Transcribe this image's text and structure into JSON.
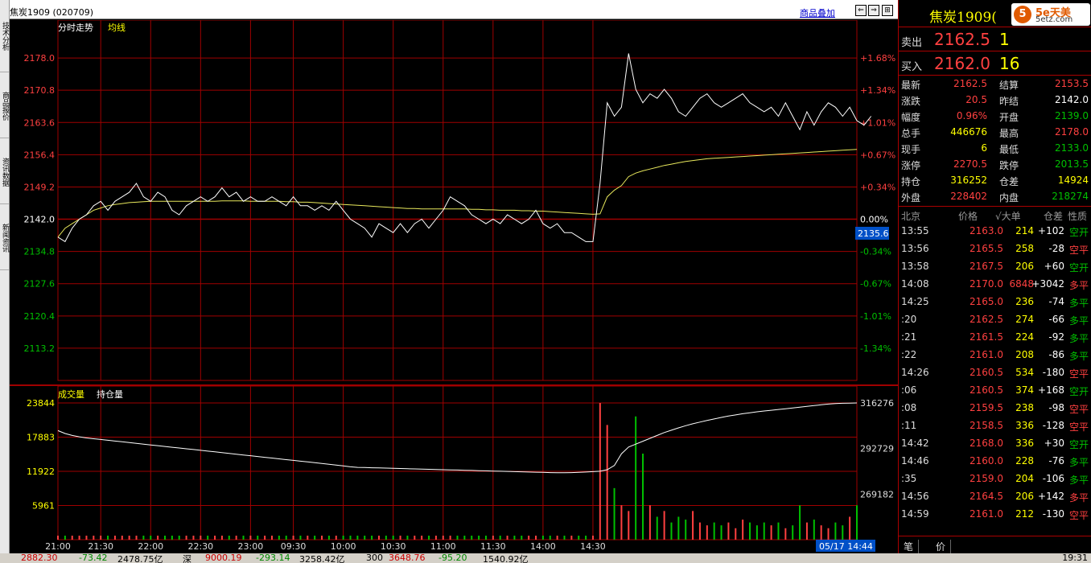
{
  "window": {
    "title": "焦炭1909 (020709)",
    "overlay_link": "商品叠加"
  },
  "side_tabs": [
    "技术分析",
    "商品报价",
    "资讯数据",
    "新闻资讯"
  ],
  "price_chart": {
    "legend_main": "分时走势",
    "legend_avg": "均线",
    "left_ticks": [
      "2178.0",
      "2170.8",
      "2163.6",
      "2156.4",
      "2149.2",
      "2142.0",
      "2134.8",
      "2127.6",
      "2120.4",
      "2113.2"
    ],
    "right_ticks": [
      "+1.68%",
      "+1.34%",
      "+1.01%",
      "+0.67%",
      "+0.34%",
      "0.00%",
      "-0.34%",
      "-0.67%",
      "-1.01%",
      "-1.34%"
    ],
    "cursor_price": "2135.6",
    "colors": {
      "up": "#ff4040",
      "down": "#00c000",
      "flat": "#ffffff",
      "grid": "#a00000",
      "avg": "#e8e85c",
      "line": "#ffffff"
    }
  },
  "volume_chart": {
    "legend_vol": "成交量",
    "legend_oi": "持仓量",
    "left_ticks": [
      "23844",
      "17883",
      "11922",
      "5961"
    ],
    "right_ticks": [
      "316276",
      "292729",
      "269182"
    ]
  },
  "x_axis": [
    "21:00",
    "21:30",
    "22:00",
    "22:30",
    "23:00",
    "09:30",
    "10:00",
    "10:30",
    "11:00",
    "11:30",
    "14:00",
    "14:30"
  ],
  "time_readout": "05/17 14:44",
  "chart_data": {
    "type": "line",
    "title": "",
    "xlabel": "",
    "ylabel": "",
    "ylim": [
      2106.0,
      2185.2
    ],
    "y_axis_ticks": [
      2178.0,
      2170.8,
      2163.6,
      2156.4,
      2149.2,
      2142.0,
      2134.8,
      2127.6,
      2120.4,
      2113.2
    ],
    "x_ticks": [
      "21:00",
      "21:30",
      "22:00",
      "22:30",
      "23:00",
      "09:30",
      "10:00",
      "10:30",
      "11:00",
      "11:30",
      "14:00",
      "14:30"
    ],
    "x_range": [
      0,
      112
    ],
    "x_tick_positions": [
      0,
      6,
      13,
      20,
      27,
      33,
      40,
      47,
      54,
      61,
      68,
      75
    ],
    "series": [
      {
        "values": [
          2138,
          2137,
          2140,
          2142,
          2143,
          2145,
          2146,
          2144,
          2146,
          2147,
          2148,
          2150,
          2147,
          2146,
          2148,
          2147,
          2144,
          2143,
          2145,
          2146,
          2147,
          2146,
          2147,
          2149,
          2147,
          2148,
          2146,
          2147,
          2146,
          2146,
          2147,
          2146,
          2145,
          2147,
          2145,
          2145,
          2144,
          2145,
          2144,
          2146,
          2144,
          2142,
          2141,
          2140,
          2138,
          2141,
          2140,
          2139,
          2141,
          2139,
          2141,
          2142,
          2140,
          2142,
          2144,
          2147,
          2146,
          2145,
          2143,
          2142,
          2141,
          2142,
          2141,
          2143,
          2142,
          2141,
          2142,
          2144,
          2141,
          2140,
          2141,
          2139,
          2139,
          2138,
          2137,
          2137,
          2150,
          2168,
          2165,
          2167,
          2179,
          2171,
          2168,
          2170,
          2169,
          2171,
          2169,
          2166,
          2165,
          2167,
          2169,
          2170,
          2168,
          2167,
          2168,
          2169,
          2170,
          2168,
          2167,
          2166,
          2167,
          2165,
          2168,
          2165,
          2162,
          2166,
          2163,
          2166,
          2168,
          2167,
          2165,
          2167,
          2164,
          2163,
          2165
        ]
      },
      {
        "values": [
          2138,
          2140,
          2141,
          2142,
          2143,
          2144,
          2144.5,
          2145,
          2145.3,
          2145.5,
          2145.7,
          2145.8,
          2145.9,
          2146,
          2146,
          2146,
          2146,
          2146,
          2146,
          2146,
          2146,
          2146,
          2146,
          2146.1,
          2146.1,
          2146.1,
          2146.1,
          2146,
          2146,
          2146,
          2146,
          2146,
          2145.9,
          2145.9,
          2145.8,
          2145.8,
          2145.7,
          2145.6,
          2145.5,
          2145.4,
          2145.3,
          2145.2,
          2145.1,
          2145,
          2144.9,
          2144.8,
          2144.7,
          2144.6,
          2144.5,
          2144.4,
          2144.4,
          2144.3,
          2144.3,
          2144.3,
          2144.3,
          2144.3,
          2144.3,
          2144.3,
          2144.2,
          2144.2,
          2144.1,
          2144.1,
          2144,
          2144,
          2144,
          2143.9,
          2143.9,
          2143.8,
          2143.8,
          2143.7,
          2143.6,
          2143.5,
          2143.4,
          2143.3,
          2143.2,
          2143.1,
          2143.2,
          2147,
          2148.5,
          2149.5,
          2151.5,
          2152.3,
          2152.8,
          2153.2,
          2153.6,
          2154,
          2154.3,
          2154.6,
          2154.9,
          2155.1,
          2155.3,
          2155.5,
          2155.6,
          2155.7,
          2155.8,
          2155.9,
          2156,
          2156.1,
          2156.2,
          2156.3,
          2156.4,
          2156.5,
          2156.6,
          2156.7,
          2156.8,
          2156.9,
          2157,
          2157.1,
          2157.2,
          2157.3,
          2157.4,
          2157.5,
          2157.6
        ]
      }
    ],
    "volume": [
      8,
      5,
      3,
      4,
      3,
      6,
      2,
      4,
      3,
      5,
      7,
      4,
      3,
      5,
      2,
      3,
      4,
      2,
      3,
      5,
      3,
      2,
      4,
      3,
      2,
      3,
      2,
      4,
      3,
      3,
      2,
      4,
      3,
      2,
      3,
      4,
      5,
      3,
      2,
      3,
      4,
      2,
      3,
      5,
      4,
      3,
      2,
      4,
      3,
      2,
      3,
      4,
      3,
      2,
      3,
      4,
      3,
      2,
      4,
      3,
      5,
      3,
      2,
      4,
      3,
      2,
      3,
      2,
      3,
      4,
      3,
      2,
      3,
      2,
      3,
      4,
      23844,
      20000,
      9000,
      6000,
      5000,
      21500,
      15000,
      6000,
      4000,
      5000,
      3000,
      4000,
      3500,
      5000,
      3000,
      2500,
      3000,
      2500,
      3000,
      2000,
      3500,
      3000,
      2500,
      3000,
      2500,
      3000,
      2000,
      2500,
      6000,
      3000,
      3500,
      2500,
      2000,
      3000,
      2500,
      4000,
      6000
    ],
    "open_interest": [
      302000,
      300500,
      299500,
      298800,
      298200,
      297800,
      297400,
      297000,
      296600,
      296200,
      295800,
      295400,
      295000,
      294600,
      294200,
      293800,
      293400,
      293000,
      292600,
      292200,
      291800,
      291400,
      291000,
      290600,
      290200,
      289800,
      289400,
      289000,
      288600,
      288200,
      287800,
      287400,
      287000,
      286600,
      286200,
      285800,
      285400,
      285000,
      284600,
      284200,
      283800,
      283300,
      283000,
      282900,
      282800,
      282700,
      282600,
      282500,
      282400,
      282300,
      282200,
      282100,
      282000,
      281900,
      281800,
      281700,
      281600,
      281500,
      281400,
      281300,
      281200,
      281100,
      281000,
      280900,
      280800,
      280700,
      280600,
      280500,
      280400,
      280300,
      280200,
      280200,
      280300,
      280400,
      280600,
      280800,
      281000,
      281800,
      284000,
      290000,
      293500,
      295000,
      296500,
      298000,
      299500,
      301000,
      302200,
      303400,
      304500,
      305500,
      306400,
      307200,
      308000,
      308800,
      309500,
      310100,
      310700,
      311200,
      311700,
      312100,
      312500,
      312900,
      313300,
      313700,
      314100,
      314500,
      314900,
      315300,
      315700,
      316000,
      316100,
      316200,
      316276
    ]
  },
  "quote": {
    "symbol": "焦炭1909(",
    "logo_text": "5e天美",
    "logo_sub": "5etz.com",
    "sell_label": "卖出",
    "sell_price": "2162.5",
    "sell_qty": "1",
    "buy_label": "买入",
    "buy_price": "2162.0",
    "buy_qty": "16",
    "rows": [
      {
        "l1": "最新",
        "v1": "2162.5",
        "c1": "#ff4040",
        "l2": "结算",
        "v2": "2153.5",
        "c2": "#ff4040"
      },
      {
        "l1": "涨跌",
        "v1": "20.5",
        "c1": "#ff4040",
        "l2": "昨结",
        "v2": "2142.0",
        "c2": "#ffffff"
      },
      {
        "l1": "幅度",
        "v1": "0.96%",
        "c1": "#ff4040",
        "l2": "开盘",
        "v2": "2139.0",
        "c2": "#00c000"
      },
      {
        "l1": "总手",
        "v1": "446676",
        "c1": "#ffff00",
        "l2": "最高",
        "v2": "2178.0",
        "c2": "#ff4040"
      },
      {
        "l1": "现手",
        "v1": "6",
        "c1": "#ffff00",
        "l2": "最低",
        "v2": "2133.0",
        "c2": "#00c000"
      },
      {
        "l1": "涨停",
        "v1": "2270.5",
        "c1": "#ff4040",
        "l2": "跌停",
        "v2": "2013.5",
        "c2": "#00c000"
      },
      {
        "l1": "持仓",
        "v1": "316252",
        "c1": "#ffff00",
        "l2": "仓差",
        "v2": "14924",
        "c2": "#ffff00"
      },
      {
        "l1": "外盘",
        "v1": "228402",
        "c1": "#ff4040",
        "l2": "内盘",
        "v2": "218274",
        "c2": "#00c000"
      }
    ],
    "tick_header": {
      "time": "北京",
      "price": "价格",
      "vol": "√大单",
      "oi": "仓差",
      "nature": "性质"
    },
    "ticks": [
      {
        "t": "13:55",
        "p": "2163.0",
        "v": "214",
        "o": "+102",
        "oc": "#ffffff",
        "n": "空开",
        "nc": "#00c000"
      },
      {
        "t": "13:56",
        "p": "2165.5",
        "v": "258",
        "o": "-28",
        "oc": "#ffffff",
        "n": "空平",
        "nc": "#ff4040"
      },
      {
        "t": "13:58",
        "p": "2167.5",
        "v": "206",
        "o": "+60",
        "oc": "#ffffff",
        "n": "空开",
        "nc": "#00c000"
      },
      {
        "t": "14:08",
        "p": "2170.0",
        "v": "6848",
        "vc": "#ff4040",
        "o": "+3042",
        "oc": "#ffffff",
        "n": "多平",
        "nc": "#ff4040"
      },
      {
        "t": "14:25",
        "p": "2165.0",
        "v": "236",
        "o": "-74",
        "oc": "#ffffff",
        "n": "多平",
        "nc": "#00c000"
      },
      {
        "t": ":20",
        "p": "2162.5",
        "v": "274",
        "o": "-66",
        "oc": "#ffffff",
        "n": "多平",
        "nc": "#00c000"
      },
      {
        "t": ":21",
        "p": "2161.5",
        "v": "224",
        "o": "-92",
        "oc": "#ffffff",
        "n": "多平",
        "nc": "#00c000"
      },
      {
        "t": ":22",
        "p": "2161.0",
        "v": "208",
        "o": "-86",
        "oc": "#ffffff",
        "n": "多平",
        "nc": "#00c000"
      },
      {
        "t": "14:26",
        "p": "2160.5",
        "v": "534",
        "o": "-180",
        "oc": "#ffffff",
        "n": "空平",
        "nc": "#ff4040"
      },
      {
        "t": ":06",
        "p": "2160.5",
        "v": "374",
        "o": "+168",
        "oc": "#ffffff",
        "n": "空开",
        "nc": "#00c000"
      },
      {
        "t": ":08",
        "p": "2159.5",
        "v": "238",
        "o": "-98",
        "oc": "#ffffff",
        "n": "空平",
        "nc": "#ff4040"
      },
      {
        "t": ":11",
        "p": "2158.5",
        "v": "336",
        "o": "-128",
        "oc": "#ffffff",
        "n": "空平",
        "nc": "#ff4040"
      },
      {
        "t": "14:42",
        "p": "2168.0",
        "v": "336",
        "o": "+30",
        "oc": "#ffffff",
        "n": "空开",
        "nc": "#00c000"
      },
      {
        "t": "14:46",
        "p": "2160.0",
        "v": "228",
        "o": "-76",
        "oc": "#ffffff",
        "n": "多平",
        "nc": "#00c000"
      },
      {
        "t": ":35",
        "p": "2159.0",
        "v": "204",
        "o": "-106",
        "oc": "#ffffff",
        "n": "多平",
        "nc": "#00c000"
      },
      {
        "t": "14:56",
        "p": "2164.5",
        "v": "206",
        "o": "+142",
        "oc": "#ffffff",
        "n": "多平",
        "nc": "#ff4040"
      },
      {
        "t": "14:59",
        "p": "2161.0",
        "v": "212",
        "o": "-130",
        "oc": "#ffffff",
        "n": "空平",
        "nc": "#ff4040"
      }
    ],
    "tabs": [
      "笔",
      "价"
    ]
  },
  "taskbar": {
    "items": [
      "2882.30",
      "-73.42",
      "2478.75亿",
      "深",
      "9000.19",
      "-293.14",
      "3258.42亿",
      "300",
      "3648.76",
      "-95.20",
      "1540.92亿"
    ],
    "clock": "19:31"
  }
}
